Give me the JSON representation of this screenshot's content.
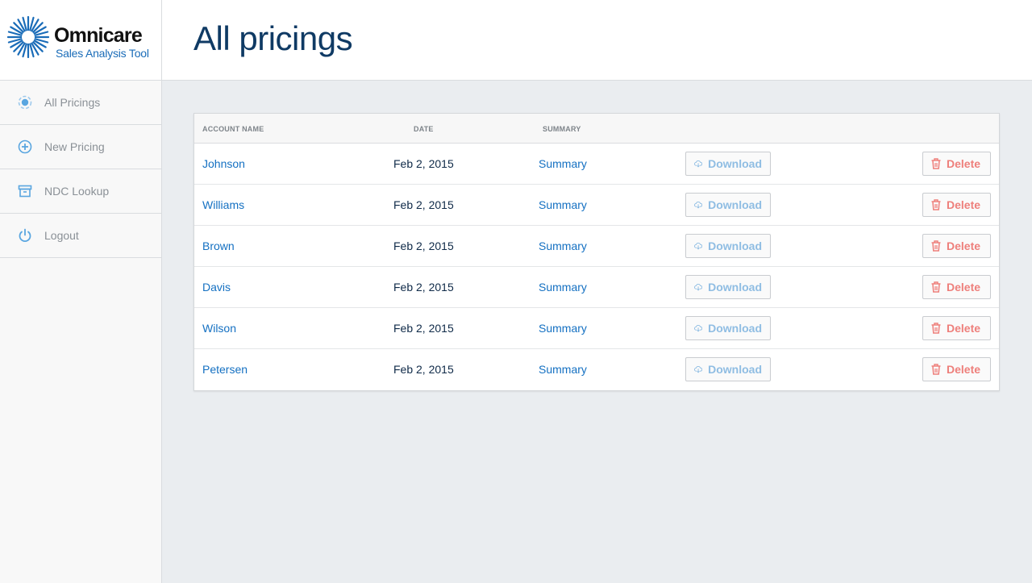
{
  "brand": {
    "name": "Omnicare",
    "subtitle": "Sales Analysis Tool",
    "color": "#1a6cb8"
  },
  "sidebar": {
    "items": [
      {
        "label": "All Pricings",
        "icon": "target-icon"
      },
      {
        "label": "New Pricing",
        "icon": "plus-circle-icon"
      },
      {
        "label": "NDC Lookup",
        "icon": "archive-icon"
      },
      {
        "label": "Logout",
        "icon": "power-icon"
      }
    ]
  },
  "page": {
    "title": "All pricings"
  },
  "table": {
    "headers": {
      "account": "ACCOUNT NAME",
      "date": "DATE",
      "summary": "SUMMARY"
    },
    "rows": [
      {
        "account": "Johnson",
        "date": "Feb 2, 2015",
        "summary": "Summary",
        "download": "Download",
        "delete": "Delete"
      },
      {
        "account": "Williams",
        "date": "Feb 2, 2015",
        "summary": "Summary",
        "download": "Download",
        "delete": "Delete"
      },
      {
        "account": "Brown",
        "date": "Feb 2, 2015",
        "summary": "Summary",
        "download": "Download",
        "delete": "Delete"
      },
      {
        "account": "Davis",
        "date": "Feb 2, 2015",
        "summary": "Summary",
        "download": "Download",
        "delete": "Delete"
      },
      {
        "account": "Wilson",
        "date": "Feb 2, 2015",
        "summary": "Summary",
        "download": "Download",
        "delete": "Delete"
      },
      {
        "account": "Petersen",
        "date": "Feb 2, 2015",
        "summary": "Summary",
        "download": "Download",
        "delete": "Delete"
      }
    ]
  },
  "colors": {
    "link": "#1470c2",
    "title": "#0f3a64",
    "download": "#8fbde3",
    "delete": "#ee7f7b",
    "nav_icon": "#5aa6e0"
  }
}
